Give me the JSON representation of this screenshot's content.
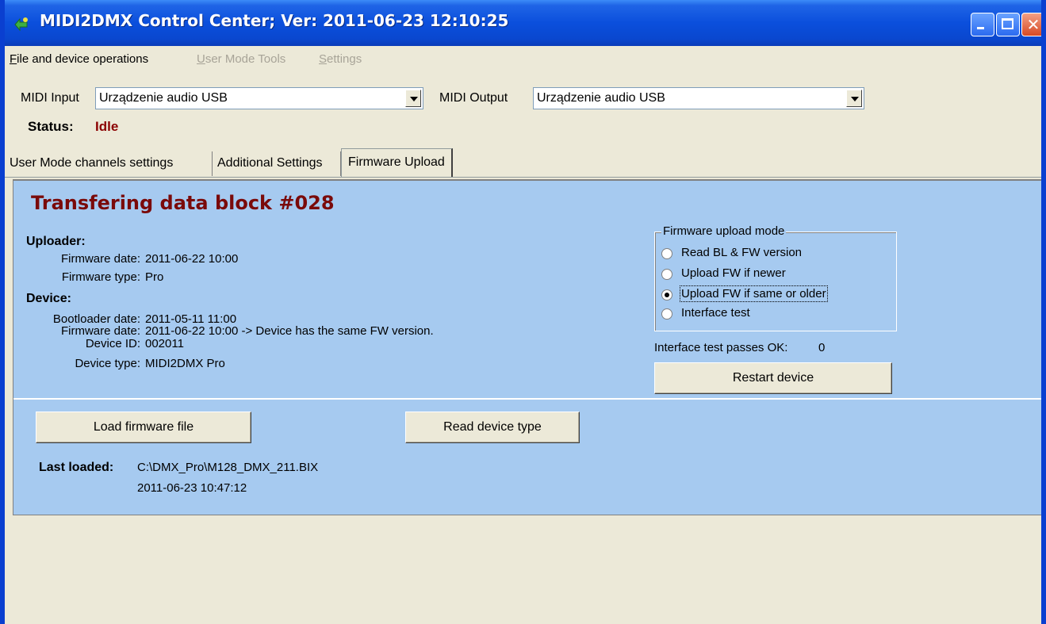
{
  "window": {
    "title": "MIDI2DMX Control Center; Ver: 2011-06-23 12:10:25"
  },
  "menu": {
    "items": [
      {
        "label": "File and device operations",
        "enabled": true
      },
      {
        "label": "User Mode Tools",
        "enabled": false
      },
      {
        "label": "Settings",
        "enabled": false
      }
    ]
  },
  "midi": {
    "input_label": "MIDI Input",
    "input_value": "Urządzenie audio USB",
    "output_label": "MIDI Output",
    "output_value": "Urządzenie audio USB"
  },
  "status": {
    "label": "Status:",
    "value": "Idle"
  },
  "tabs": [
    {
      "label": "User Mode channels settings",
      "active": false
    },
    {
      "label": "Additional Settings",
      "active": false
    },
    {
      "label": "Firmware Upload",
      "active": true
    }
  ],
  "firmware": {
    "heading": "Transfering data block #028",
    "uploader": {
      "title": "Uploader:",
      "fw_date_label": "Firmware date:",
      "fw_date": "2011-06-22 10:00",
      "fw_type_label": "Firmware type:",
      "fw_type": "Pro"
    },
    "device": {
      "title": "Device:",
      "bl_date_label": "Bootloader date:",
      "bl_date": "2011-05-11 11:00",
      "fw_date_label": "Firmware date:",
      "fw_date": "2011-06-22 10:00 -> Device has the same FW version.",
      "id_label": "Device ID:",
      "id": "002011",
      "type_label": "Device type:",
      "type": "MIDI2DMX Pro"
    },
    "upload_mode": {
      "title": "Firmware upload mode",
      "options": [
        {
          "label": "Read BL & FW version",
          "selected": false
        },
        {
          "label": "Upload FW if newer",
          "selected": false
        },
        {
          "label": "Upload FW if same or older",
          "selected": true
        },
        {
          "label": "Interface test",
          "selected": false
        }
      ]
    },
    "interface_test": {
      "label": "Interface test passes OK:",
      "value": "0"
    },
    "restart_button": "Restart device",
    "load_button": "Load firmware file",
    "read_type_button": "Read device type",
    "last_loaded": {
      "label": "Last loaded:",
      "path": "C:\\DMX_Pro\\M128_DMX_211.BIX",
      "timestamp": "2011-06-23 10:47:12"
    }
  }
}
